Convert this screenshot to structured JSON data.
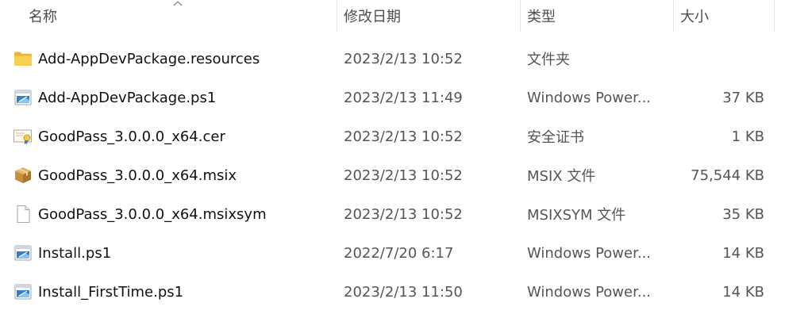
{
  "columns": {
    "name": "名称",
    "date": "修改日期",
    "type": "类型",
    "size": "大小"
  },
  "files": [
    {
      "name": "Add-AppDevPackage.resources",
      "date": "2023/2/13 10:52",
      "type": "文件夹",
      "size": "",
      "icon": "folder-icon"
    },
    {
      "name": "Add-AppDevPackage.ps1",
      "date": "2023/2/13 11:49",
      "type": "Windows Power...",
      "size": "37 KB",
      "icon": "powershell-script-icon"
    },
    {
      "name": "GoodPass_3.0.0.0_x64.cer",
      "date": "2023/2/13 10:52",
      "type": "安全证书",
      "size": "1 KB",
      "icon": "certificate-icon"
    },
    {
      "name": "GoodPass_3.0.0.0_x64.msix",
      "date": "2023/2/13 10:52",
      "type": "MSIX 文件",
      "size": "75,544 KB",
      "icon": "package-box-icon"
    },
    {
      "name": "GoodPass_3.0.0.0_x64.msixsym",
      "date": "2023/2/13 10:52",
      "type": "MSIXSYM 文件",
      "size": "35 KB",
      "icon": "blank-file-icon"
    },
    {
      "name": "Install.ps1",
      "date": "2022/7/20 6:17",
      "type": "Windows Power...",
      "size": "14 KB",
      "icon": "powershell-script-icon"
    },
    {
      "name": "Install_FirstTime.ps1",
      "date": "2023/2/13 11:50",
      "type": "Windows Power...",
      "size": "14 KB",
      "icon": "powershell-script-icon"
    }
  ]
}
